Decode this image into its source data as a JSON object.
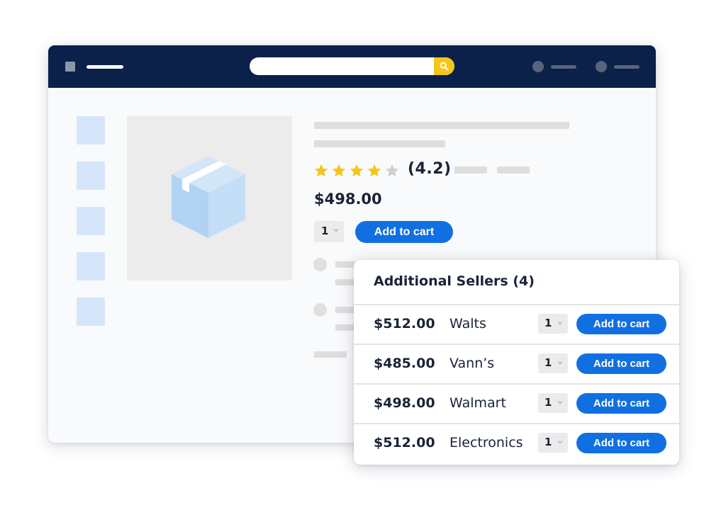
{
  "product": {
    "rating_display": "(4.2)",
    "rating_value": 4.2,
    "rating_max": 5,
    "price": "$498.00",
    "quantity": "1",
    "add_to_cart_label": "Add to cart"
  },
  "sellers": {
    "title": "Additional Sellers",
    "count": "(4)",
    "rows": [
      {
        "price": "$512.00",
        "seller": "Walts",
        "quantity": "1",
        "button": "Add to cart"
      },
      {
        "price": "$485.00",
        "seller": "Vann’s",
        "quantity": "1",
        "button": "Add to cart"
      },
      {
        "price": "$498.00",
        "seller": "Walmart",
        "quantity": "1",
        "button": "Add to cart"
      },
      {
        "price": "$512.00",
        "seller": "Electronics",
        "quantity": "1",
        "button": "Add to cart"
      }
    ]
  },
  "icons": {
    "search": "search-icon",
    "product_image": "package-box-icon",
    "star_filled": "star-icon",
    "star_empty": "star-outline-icon",
    "dropdown": "chevron-down-icon"
  },
  "colors": {
    "topbar": "#0c2149",
    "accent_button": "#1170e1",
    "search_button": "#f5c518",
    "star_filled": "#f5c518",
    "star_empty": "#cfcfcf",
    "placeholder_image": "#d6e6fa",
    "text": "#1a2336"
  }
}
